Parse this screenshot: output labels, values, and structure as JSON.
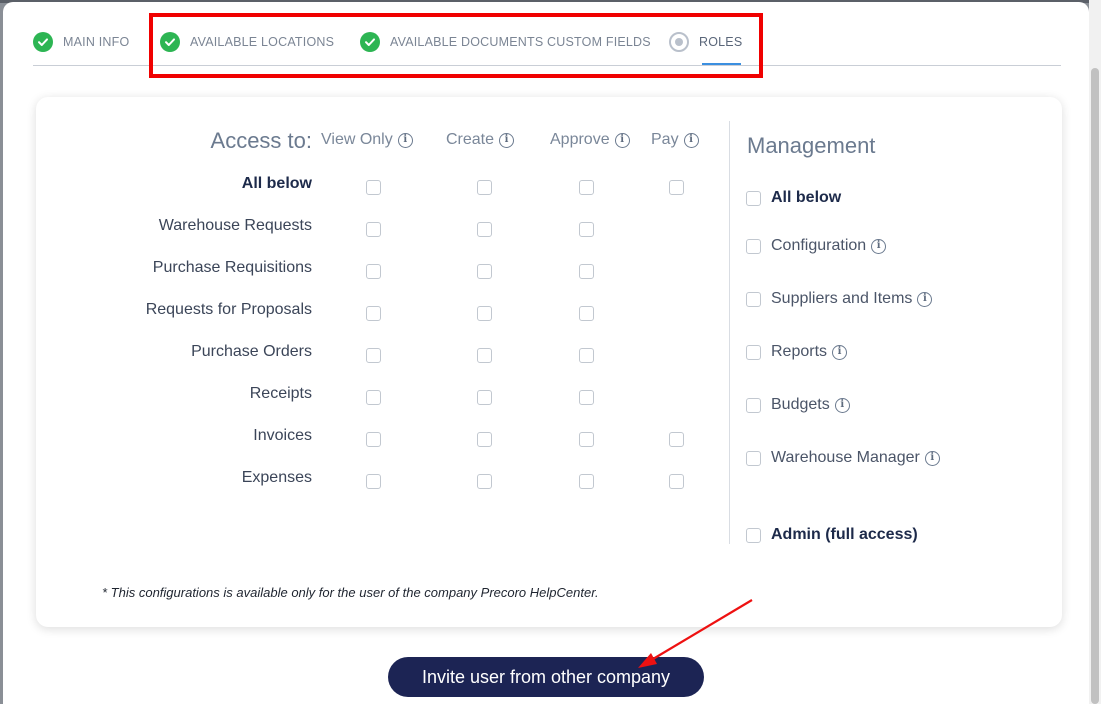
{
  "tabs": [
    {
      "label": "MAIN INFO",
      "state": "complete"
    },
    {
      "label": "AVAILABLE LOCATIONS",
      "state": "complete"
    },
    {
      "label": "AVAILABLE DOCUMENTS CUSTOM FIELDS",
      "state": "complete"
    },
    {
      "label": "ROLES",
      "state": "current"
    }
  ],
  "access": {
    "title": "Access to:",
    "columns": [
      "View Only",
      "Create",
      "Approve",
      "Pay"
    ],
    "rows": [
      {
        "label": "All below",
        "bold": true,
        "checkboxes": [
          false,
          false,
          false,
          false
        ]
      },
      {
        "label": "Warehouse Requests",
        "checkboxes": [
          false,
          false,
          false
        ]
      },
      {
        "label": "Purchase Requisitions",
        "checkboxes": [
          false,
          false,
          false
        ]
      },
      {
        "label": "Requests for Proposals",
        "checkboxes": [
          false,
          false,
          false
        ]
      },
      {
        "label": "Purchase Orders",
        "checkboxes": [
          false,
          false,
          false
        ]
      },
      {
        "label": "Receipts",
        "checkboxes": [
          false,
          false,
          false
        ]
      },
      {
        "label": "Invoices",
        "checkboxes": [
          false,
          false,
          false,
          false
        ]
      },
      {
        "label": "Expenses",
        "checkboxes": [
          false,
          false,
          false,
          false
        ]
      }
    ]
  },
  "management": {
    "title": "Management",
    "items": [
      {
        "label": "All below",
        "bold": true,
        "info": false
      },
      {
        "label": "Configuration",
        "info": true
      },
      {
        "label": "Suppliers and Items",
        "info": true
      },
      {
        "label": "Reports",
        "info": true
      },
      {
        "label": "Budgets",
        "info": true
      },
      {
        "label": "Warehouse Manager",
        "info": true
      },
      {
        "label": "Admin (full access)",
        "bold": true,
        "info": false
      }
    ]
  },
  "note": "* This configurations is available only for the user of the company Precoro HelpCenter.",
  "invite_button": "Invite user from other company",
  "colors": {
    "complete": "#2db553",
    "primary": "#1c2454",
    "highlight": "#f00000",
    "tab_active": "#3b8fe0"
  }
}
